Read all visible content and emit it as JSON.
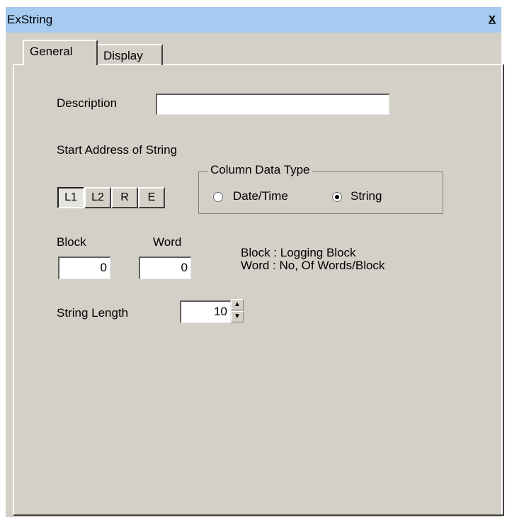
{
  "window": {
    "title": "ExString",
    "close_label": "x"
  },
  "tabs": [
    {
      "label": "General"
    },
    {
      "label": "Display"
    }
  ],
  "general": {
    "description_label": "Description",
    "description_value": "",
    "start_address_label": "Start Address of String",
    "device_buttons": [
      {
        "label": "L1",
        "selected": true
      },
      {
        "label": "L2",
        "selected": false
      },
      {
        "label": "R",
        "selected": false
      },
      {
        "label": "E",
        "selected": false
      }
    ],
    "column_data_type": {
      "legend": "Column Data Type",
      "options": [
        {
          "label": "Date/Time",
          "selected": false
        },
        {
          "label": "String",
          "selected": true
        }
      ]
    },
    "block_label": "Block",
    "block_value": "0",
    "word_label": "Word",
    "word_value": "0",
    "help_line1": "Block : Logging Block",
    "help_line2": "Word : No, Of Words/Block",
    "string_length_label": "String Length",
    "string_length_value": "10",
    "spin_up_icon": "up-arrow",
    "spin_down_icon": "down-arrow"
  }
}
